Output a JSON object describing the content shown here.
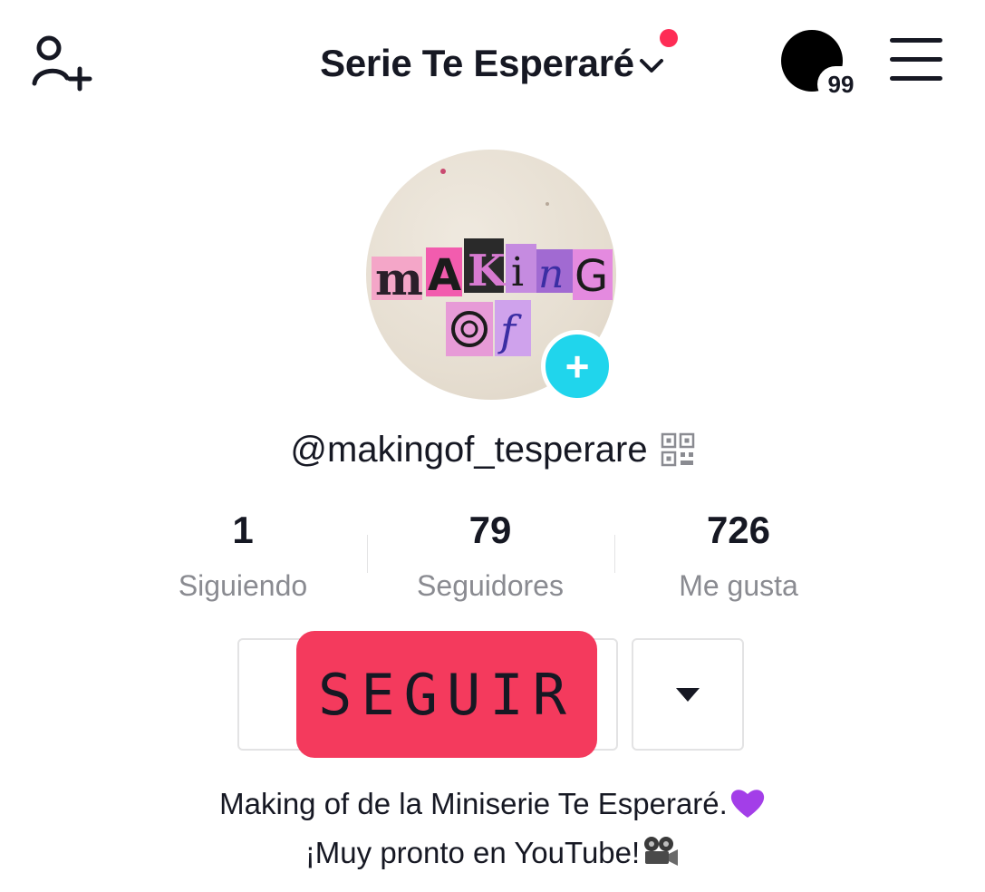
{
  "header": {
    "title": "Serie Te Esperaré",
    "notification_badge": "99",
    "accent_dot_color": "#fe2c55"
  },
  "profile": {
    "avatar_text_line1": "makinG",
    "avatar_text_line2": "of",
    "username": "@makingof_tesperare"
  },
  "stats": [
    {
      "value": "1",
      "label": "Siguiendo"
    },
    {
      "value": "79",
      "label": "Seguidores"
    },
    {
      "value": "726",
      "label": "Me gusta"
    }
  ],
  "actions": {
    "follow_label": "SEGUIR",
    "follow_color": "#f43a5d"
  },
  "bio": {
    "line1": "Making of de la Miniserie Te Esperaré.",
    "line1_emoji": "purple-heart",
    "line2": "¡Muy pronto en YouTube!",
    "line2_emoji": "film-projector"
  },
  "icons": [
    "add-user-icon",
    "chevron-down-icon",
    "inbox-badge-icon",
    "hamburger-menu-icon",
    "qr-code-icon",
    "plus-icon",
    "caret-down-icon"
  ]
}
